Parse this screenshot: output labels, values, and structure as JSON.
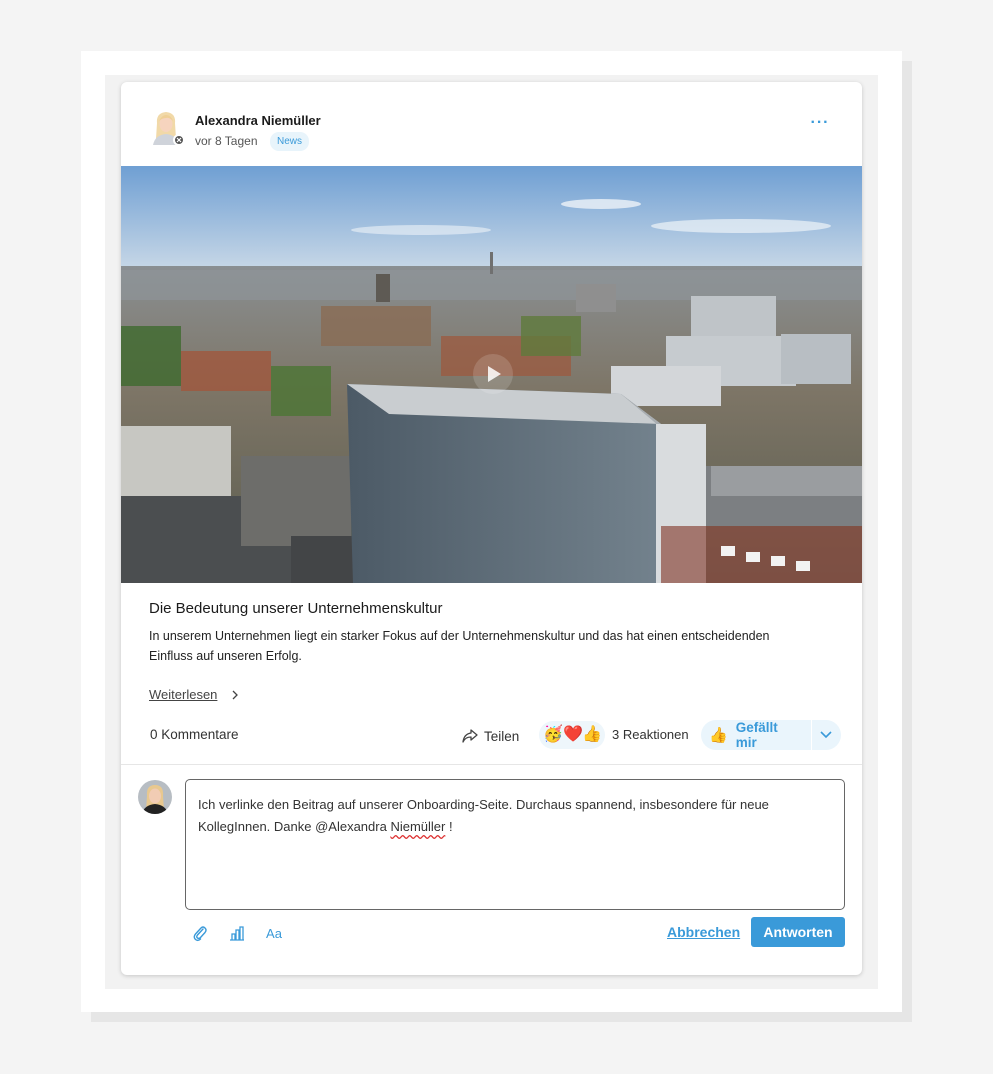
{
  "post": {
    "author": "Alexandra Niemüller",
    "time": "vor 8 Tagen",
    "badge": "News",
    "title": "Die Bedeutung unserer Unternehmenskultur",
    "body": "In unserem Unternehmen liegt ein starker Fokus auf der Unternehmenskultur und das hat einen entscheidenden Einfluss auf unseren Erfolg.",
    "read_more": "Weiterlesen",
    "more_menu": "···"
  },
  "footer": {
    "comments": "0 Kommentare",
    "share": "Teilen",
    "reaction_emojis": [
      "🥳",
      "❤️",
      "👍"
    ],
    "reactions": "3 Reaktionen",
    "like_emoji": "👍",
    "like": "Gefällt mir"
  },
  "reply": {
    "text_before": "Ich verlinke den Beitrag auf unserer Onboarding-Seite. Durchaus spannend, insbesondere für neue KollegInnen. Danke @Alexandra ",
    "mention_word": "Niemüller",
    "text_after": " !",
    "text_format_label": "Aa",
    "cancel": "Abbrechen",
    "submit": "Antworten"
  },
  "icons": {
    "attachment": "paperclip-icon",
    "poll": "bar-chart-icon",
    "text_format": "text-format-icon",
    "share": "share-arrow-icon",
    "play": "play-icon",
    "dropdown": "chevron-down-icon",
    "status": "close-icon"
  },
  "colors": {
    "accent": "#3a9ad9",
    "badge_bg": "#e8f4fb",
    "like_bg": "#eaf5fc"
  }
}
